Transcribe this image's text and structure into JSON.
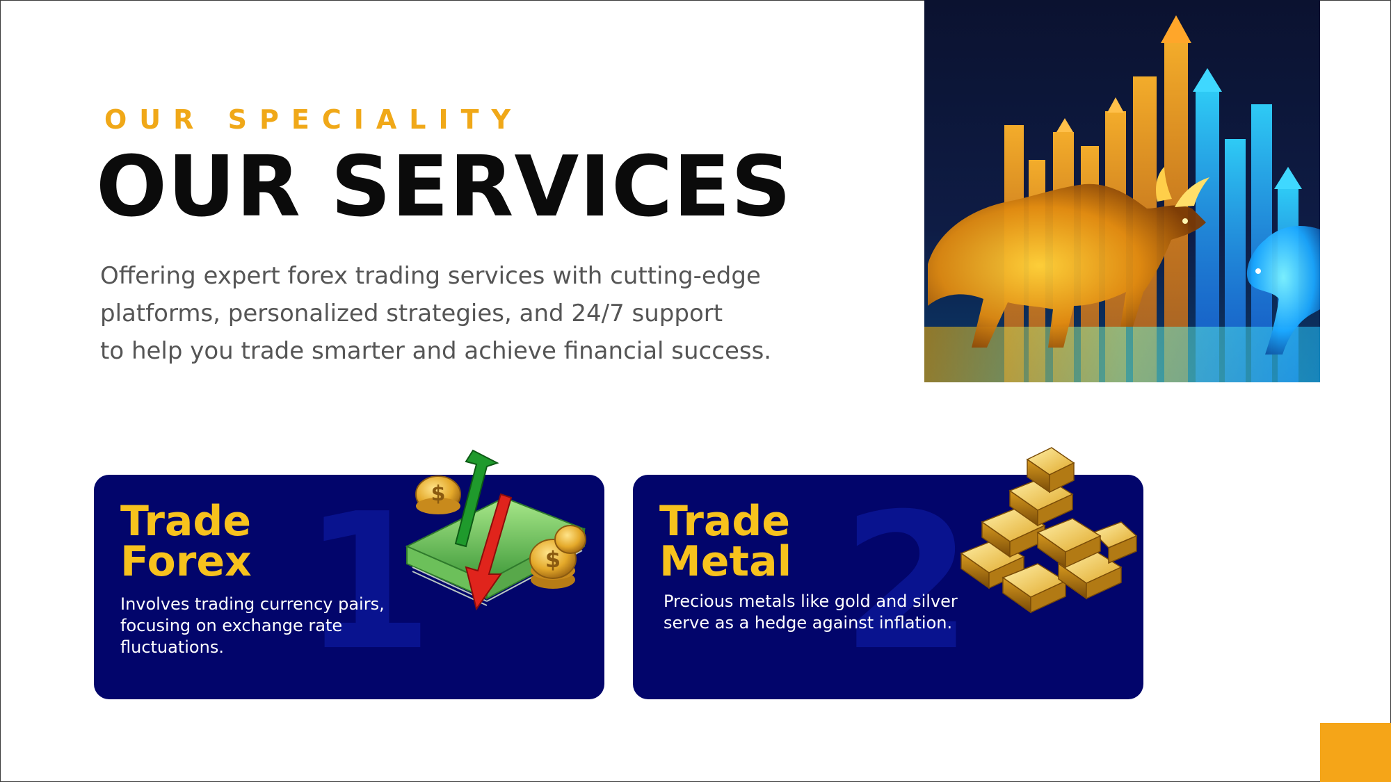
{
  "header": {
    "eyebrow": "OUR SPECIALITY",
    "title": "OUR SERVICES",
    "intro_lines": [
      "Offering expert forex trading services with cutting-edge",
      "platforms, personalized strategies, and 24/7 support",
      "to help you trade smarter and achieve financial success."
    ]
  },
  "services": [
    {
      "number": "1",
      "title_lines": [
        "Trade",
        "Forex"
      ],
      "description_lines": [
        "Involves trading currency pairs,",
        "focusing on exchange rate",
        "fluctuations."
      ],
      "icon": "money-exchange-icon"
    },
    {
      "number": "2",
      "title_lines": [
        "Trade",
        "Metal"
      ],
      "description_lines": [
        "Precious metals like gold and silver",
        "serve as a hedge against inflation."
      ],
      "icon": "gold-bars-icon"
    }
  ],
  "colors": {
    "accent": "#f0a818",
    "title": "#0b0b0b",
    "body_text": "#555555",
    "card_bg": "#02056b",
    "card_title": "#f7c21d",
    "corner_block": "#f5a518"
  }
}
